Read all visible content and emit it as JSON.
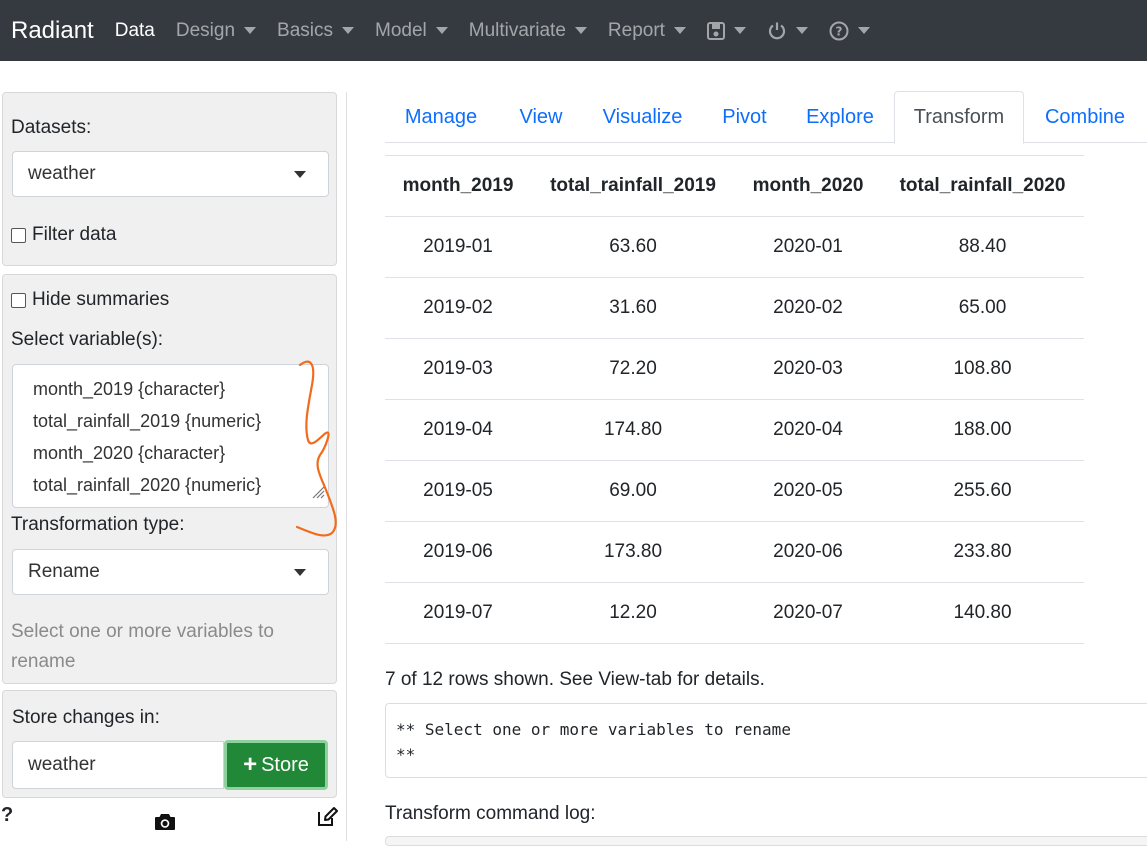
{
  "navbar": {
    "brand": "Radiant",
    "items": [
      {
        "label": "Data",
        "active": true,
        "dropdown": false
      },
      {
        "label": "Design",
        "dropdown": true
      },
      {
        "label": "Basics",
        "dropdown": true
      },
      {
        "label": "Model",
        "dropdown": true
      },
      {
        "label": "Multivariate",
        "dropdown": true
      },
      {
        "label": "Report",
        "dropdown": true
      }
    ],
    "icons": [
      "save-icon",
      "power-icon",
      "help-circle-icon"
    ]
  },
  "sidebar": {
    "datasets_label": "Datasets:",
    "dataset_value": "weather",
    "filter_label": "Filter data",
    "hide_summaries_label": "Hide summaries",
    "select_vars_label": "Select variable(s):",
    "variables": [
      "month_2019 {character}",
      "total_rainfall_2019 {numeric}",
      "month_2020 {character}",
      "total_rainfall_2020 {numeric}"
    ],
    "transform_type_label": "Transformation type:",
    "transform_type_value": "Rename",
    "hint": "Select one or more variables to rename",
    "store_label": "Store changes in:",
    "store_value": "weather",
    "store_button": "Store",
    "help_symbol": "?"
  },
  "tabs": [
    {
      "label": "Manage"
    },
    {
      "label": "View"
    },
    {
      "label": "Visualize"
    },
    {
      "label": "Pivot"
    },
    {
      "label": "Explore"
    },
    {
      "label": "Transform",
      "active": true
    },
    {
      "label": "Combine"
    }
  ],
  "table": {
    "headers": [
      "month_2019",
      "total_rainfall_2019",
      "month_2020",
      "total_rainfall_2020"
    ],
    "rows": [
      [
        "2019-01",
        "63.60",
        "2020-01",
        "88.40"
      ],
      [
        "2019-02",
        "31.60",
        "2020-02",
        "65.00"
      ],
      [
        "2019-03",
        "72.20",
        "2020-03",
        "108.80"
      ],
      [
        "2019-04",
        "174.80",
        "2020-04",
        "188.00"
      ],
      [
        "2019-05",
        "69.00",
        "2020-05",
        "255.60"
      ],
      [
        "2019-06",
        "173.80",
        "2020-06",
        "233.80"
      ],
      [
        "2019-07",
        "12.20",
        "2020-07",
        "140.80"
      ]
    ]
  },
  "rows_note": "7 of 12 rows shown. See View-tab for details.",
  "output_text": "** Select one or more variables to rename\n**",
  "log_label": "Transform command log:",
  "colors": {
    "navbar": "#343a40",
    "link": "#0d6efd",
    "store_button": "#218838",
    "scribble": "#f26b1d"
  }
}
